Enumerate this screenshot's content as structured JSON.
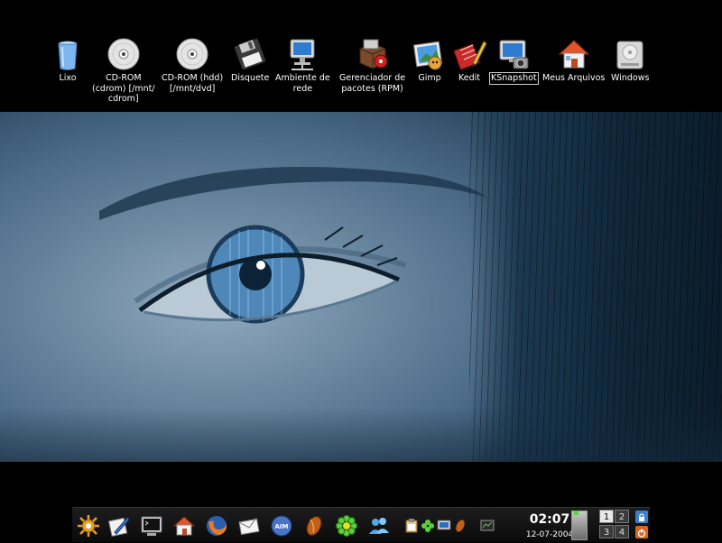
{
  "desktop": {
    "icons": [
      {
        "name": "trash-icon",
        "label": "Lixo"
      },
      {
        "name": "cdrom-icon",
        "label": "CD-ROM\n(cdrom) [/mnt/\ncdrom]"
      },
      {
        "name": "cdrom-hdd-icon",
        "label": "CD-ROM (hdd)\n[/mnt/dvd]"
      },
      {
        "name": "floppy-icon",
        "label": "Disquete"
      },
      {
        "name": "network-icon",
        "label": "Ambiente de\nrede"
      },
      {
        "name": "package-manager-icon",
        "label": "Gerenciador de\npacotes (RPM)"
      },
      {
        "name": "gimp-icon",
        "label": "Gimp"
      },
      {
        "name": "kedit-icon",
        "label": "Kedit"
      },
      {
        "name": "ksnapshot-icon",
        "label": "KSnapshot"
      },
      {
        "name": "home-icon",
        "label": "Meus Arquivos"
      },
      {
        "name": "windows-drive-icon",
        "label": "Windows"
      }
    ]
  },
  "taskbar": {
    "launchers": [
      "kde-menu-icon",
      "kwrite-icon",
      "terminal-icon",
      "home-folder-icon",
      "firefox-icon",
      "mail-icon",
      "messenger-icon",
      "bittorrent-icon",
      "icq-icon",
      "contacts-icon"
    ],
    "tray": [
      "klipper-icon",
      "clover-icon",
      "display-icon",
      "network-status-icon",
      "monitor-icon"
    ],
    "clock": {
      "time": "02:07",
      "date": "12-07-2004"
    },
    "pager": {
      "desktops": [
        "1",
        "2",
        "3",
        "4"
      ],
      "active": "1"
    },
    "session": [
      "lock-icon",
      "logout-icon"
    ]
  },
  "colors": {
    "wallpaper_tone": "#6e8aa3",
    "iris": "#4f87b8",
    "taskbar": "#121212",
    "pager_active": "#e8e8e8"
  }
}
